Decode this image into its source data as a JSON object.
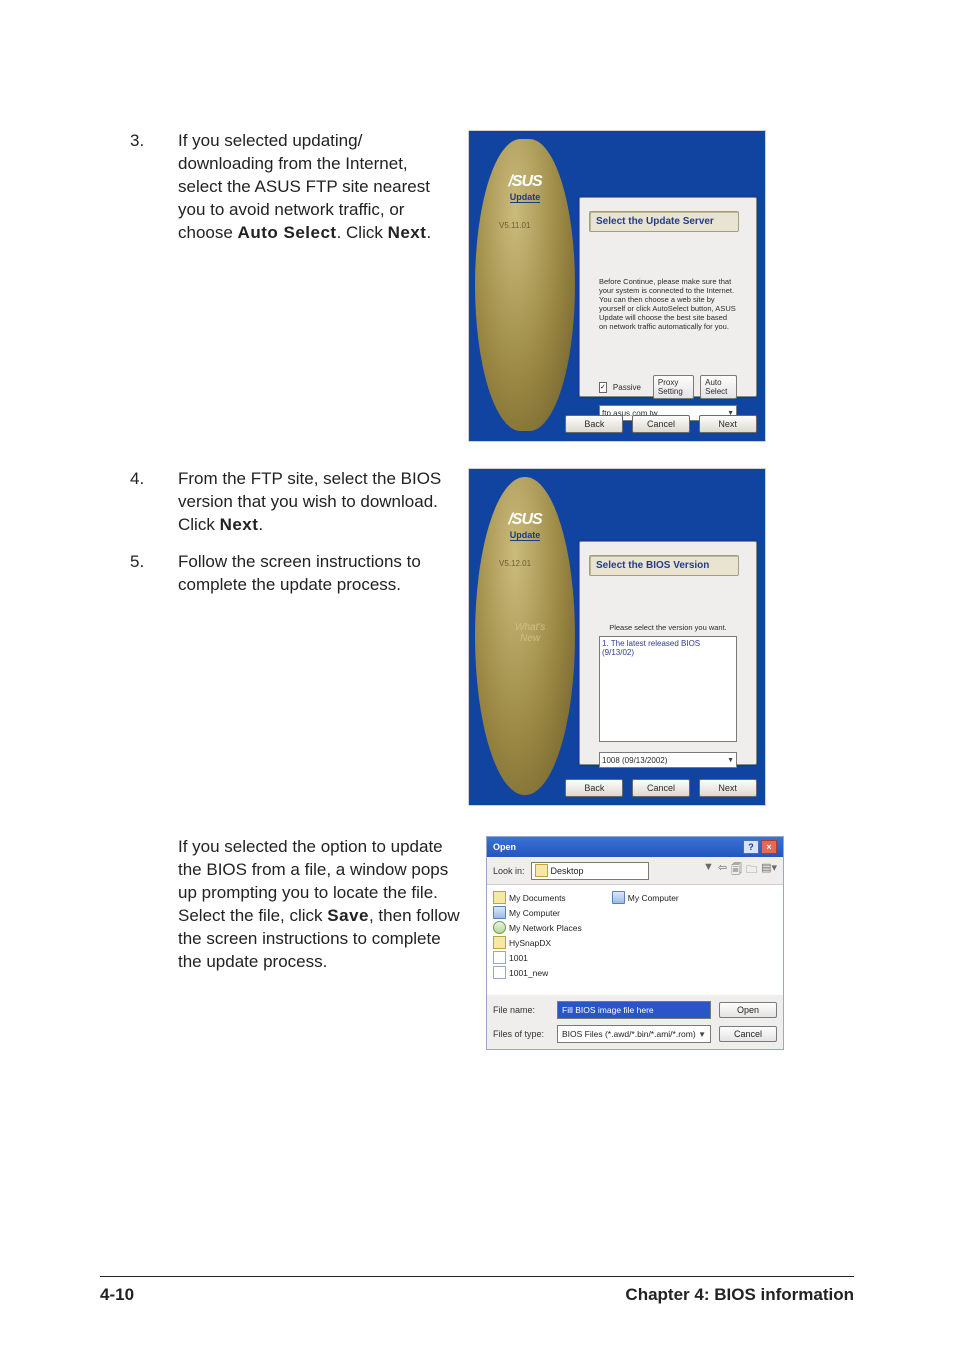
{
  "steps": {
    "n3": "3.",
    "t3_a": "If you selected updating/ downloading from the Internet, select the ASUS FTP site nearest you to avoid network traffic, or choose ",
    "t3_b1": "Auto Select",
    "t3_b2": ". Click ",
    "t3_b3": "Next",
    "t3_b4": ".",
    "n4": "4.",
    "t4_a": "From the FTP site, select the BIOS version that you wish to download. Click ",
    "t4_b1": "Next",
    "t4_b2": ".",
    "n5": "5.",
    "t5": "Follow the screen instructions to complete the update process.",
    "p3_a": "If you selected the option to update the BIOS from a file, a window pops up prompting you to locate the file. Select the file, click ",
    "p3_b1": "Save",
    "p3_b2": ", then follow the screen instructions to complete the update process."
  },
  "shot1": {
    "brand": "/SUS",
    "update_label": "Update",
    "version": "V5.11.01",
    "title": "Select the Update Server",
    "body": "Before Continue, please make sure that your system is connected to the Internet. You can then choose a web site by yourself or click AutoSelect button, ASUS Update will choose the best site based on network traffic automatically for you.",
    "passive": "Passive",
    "proxy_btn": "Proxy Setting",
    "auto_btn": "Auto Select",
    "server": "ftp.asus.com.tw",
    "back": "Back",
    "cancel": "Cancel",
    "next": "Next"
  },
  "shot2": {
    "brand": "/SUS",
    "update_label": "Update",
    "version": "V5.12.01",
    "whats": "What's",
    "new": "New",
    "title": "Select the BIOS Version",
    "prompt": "Please select the version you want.",
    "list_item": "1. The latest released BIOS (9/13/02)",
    "selected": "1008 (09/13/2002)",
    "back": "Back",
    "cancel": "Cancel",
    "next": "Next"
  },
  "openDlg": {
    "title": "Open",
    "help_icon": "?",
    "close_icon": "×",
    "lookin_label": "Look in:",
    "lookin_value": "Desktop",
    "toolbar_icons": [
      "▼",
      "⇦",
      "🗐",
      "🗀",
      "▤▾"
    ],
    "col1": [
      {
        "icon": "doc",
        "label": "My Documents"
      },
      {
        "icon": "comp",
        "label": "My Computer"
      },
      {
        "icon": "net",
        "label": "My Network Places"
      },
      {
        "icon": "folder",
        "label": "HySnapDX"
      },
      {
        "icon": "file",
        "label": "1001"
      },
      {
        "icon": "file",
        "label": "1001_new"
      }
    ],
    "col2": [
      {
        "icon": "comp",
        "label": "My Computer"
      }
    ],
    "filename_label": "File name:",
    "filename_value": "Fill BIOS image file here",
    "filetype_label": "Files of type:",
    "filetype_value": "BIOS Files (*.awd/*.bin/*.ami/*.rom)",
    "open_btn": "Open",
    "cancel_btn": "Cancel"
  },
  "footer": {
    "page_num": "4-10",
    "chapter": "Chapter 4: BIOS information"
  }
}
